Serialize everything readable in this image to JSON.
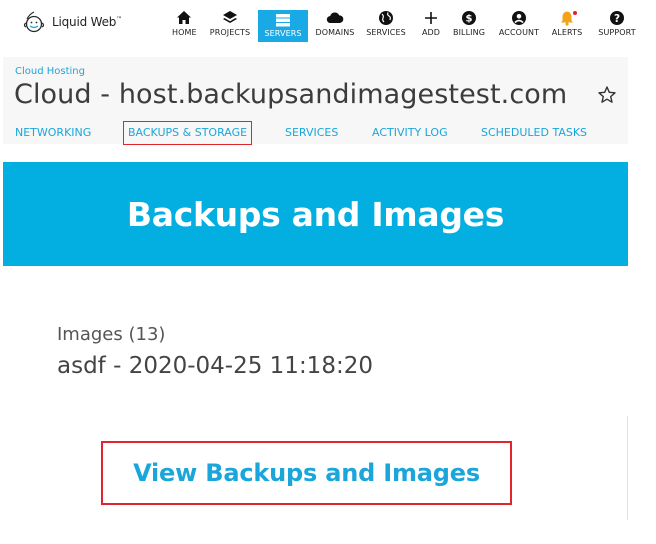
{
  "brand": {
    "name": "Liquid Web",
    "tm": "™"
  },
  "nav": {
    "items": [
      {
        "label": "HOME",
        "icon": "home-icon"
      },
      {
        "label": "PROJECTS",
        "icon": "layers-icon"
      },
      {
        "label": "SERVERS",
        "icon": "server-icon",
        "active": true
      },
      {
        "label": "DOMAINS",
        "icon": "cloud-icon"
      },
      {
        "label": "SERVICES",
        "icon": "globe-icon"
      },
      {
        "label": "ADD",
        "icon": "plus-icon"
      },
      {
        "label": "BILLING",
        "icon": "dollar-icon"
      },
      {
        "label": "ACCOUNT",
        "icon": "user-icon"
      },
      {
        "label": "ALERTS",
        "icon": "bell-icon"
      },
      {
        "label": "SUPPORT",
        "icon": "help-icon"
      }
    ]
  },
  "header": {
    "breadcrumb": "Cloud Hosting",
    "title": "Cloud - host.backupsandimagestest.com",
    "tabs": [
      {
        "label": "NETWORKING"
      },
      {
        "label": "BACKUPS & STORAGE",
        "highlighted": true
      },
      {
        "label": "SERVICES"
      },
      {
        "label": "ACTIVITY LOG"
      },
      {
        "label": "SCHEDULED TASKS"
      }
    ]
  },
  "hero": {
    "title": "Backups and Images"
  },
  "content": {
    "images_label": "Images (13)",
    "latest_image": "asdf - 2020-04-25 11:18:20",
    "cta_label": "View Backups and Images"
  },
  "colors": {
    "accent": "#19a9e5",
    "hero": "#03aee1",
    "highlight": "#e2242f",
    "alert": "#e2242f"
  }
}
